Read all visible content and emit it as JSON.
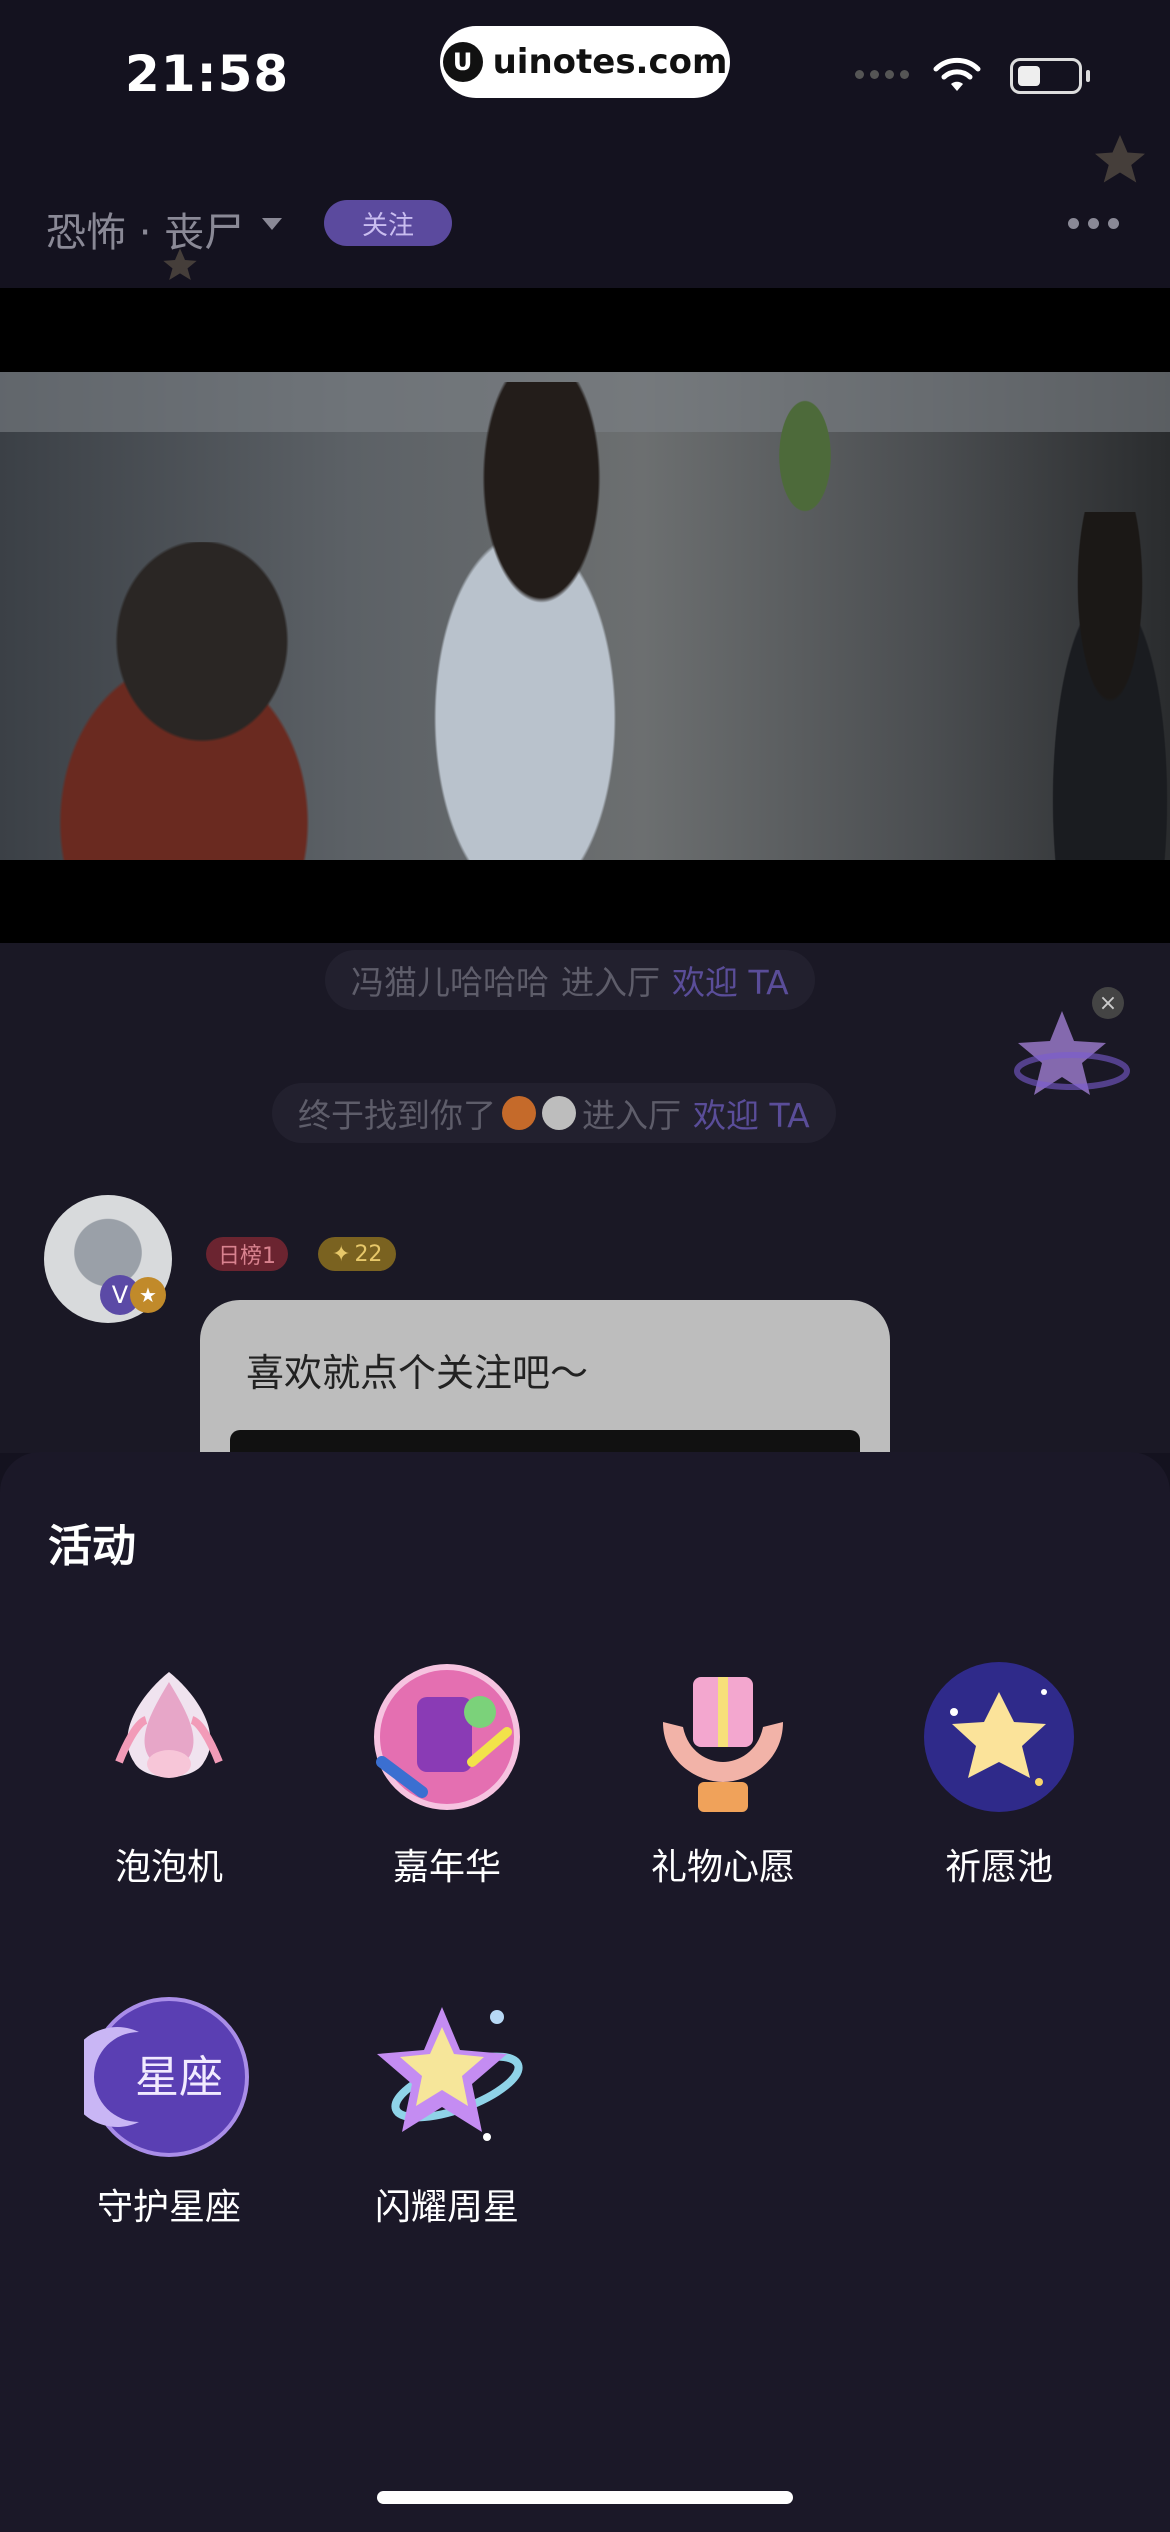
{
  "status_bar": {
    "time": "21:58",
    "watermark_text": "uinotes.com"
  },
  "header": {
    "room_title": "恐怖 · 丧尸",
    "follow_label": "关注"
  },
  "chat": {
    "notices": [
      {
        "name": "冯猫儿哈哈哈",
        "action": "进入厅",
        "welcome": "欢迎 TA"
      },
      {
        "name": "终于找到你了",
        "action": "进入厅",
        "welcome": "欢迎 TA"
      }
    ],
    "user_badges": {
      "rank": "日榜1",
      "level": "22"
    },
    "bubble_text": "喜欢就点个关注吧～"
  },
  "sheet": {
    "title": "活动",
    "activities": [
      {
        "label": "泡泡机",
        "icon": "bubble-machine-icon"
      },
      {
        "label": "嘉年华",
        "icon": "carnival-icon"
      },
      {
        "label": "礼物心愿",
        "icon": "gift-wish-icon"
      },
      {
        "label": "祈愿池",
        "icon": "wishing-pool-icon"
      },
      {
        "label": "守护星座",
        "icon": "guardian-constellation-icon"
      },
      {
        "label": "闪耀周星",
        "icon": "weekly-star-icon"
      }
    ]
  },
  "colors": {
    "accent": "#5b4a9e",
    "sheet_bg": "#1b1828"
  }
}
